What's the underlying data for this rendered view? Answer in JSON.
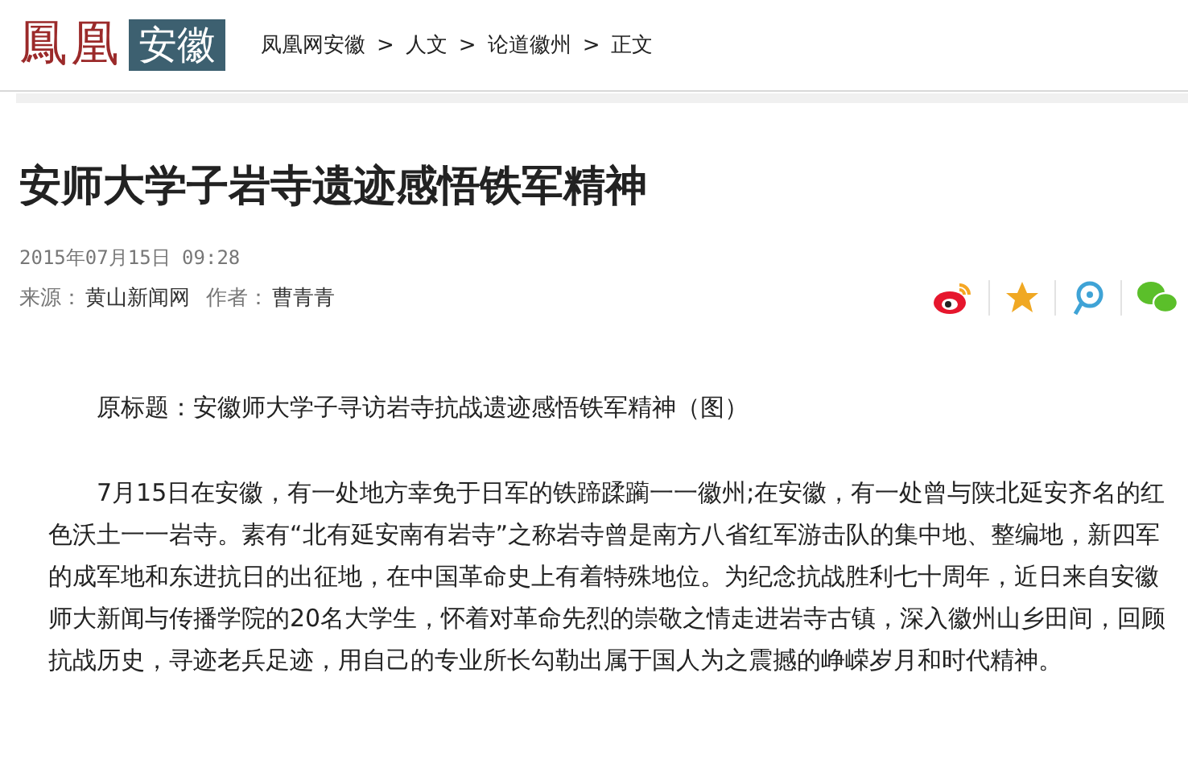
{
  "header": {
    "logo": {
      "main": "鳳凰",
      "region": "安徽"
    },
    "breadcrumb": [
      "凤凰网安徽",
      "人文",
      "论道徽州",
      "正文"
    ],
    "separator": ">"
  },
  "article": {
    "title": "安师大学子岩寺遗迹感悟铁军精神",
    "datetime": "2015年07月15日 09:28",
    "source_label": "来源：",
    "source": "黄山新闻网",
    "author_label": "作者：",
    "author": "曹青青",
    "share": [
      {
        "kind": "weibo"
      },
      {
        "kind": "qzone"
      },
      {
        "kind": "tweibo"
      },
      {
        "kind": "wechat"
      }
    ],
    "paragraphs": [
      "原标题：安徽师大学子寻访岩寺抗战遗迹感悟铁军精神（图）",
      "7月15日在安徽，有一处地方幸免于日军的铁蹄蹂躏一一徽州;在安徽，有一处曾与陕北延安齐名的红色沃土一一岩寺。素有“北有延安南有岩寺”之称岩寺曾是南方八省红军游击队的集中地、整编地，新四军的成军地和东进抗日的出征地，在中国革命史上有着特殊地位。为纪念抗战胜利七十周年，近日来自安徽师大新闻与传播学院的20名大学生，怀着对革命先烈的崇敬之情走进岩寺古镇，深入徽州山乡田间，回顾抗战历史，寻迹老兵足迹，用自己的专业所长勾勒出属于国人为之震撼的峥嵘岁月和时代精神。"
    ]
  }
}
